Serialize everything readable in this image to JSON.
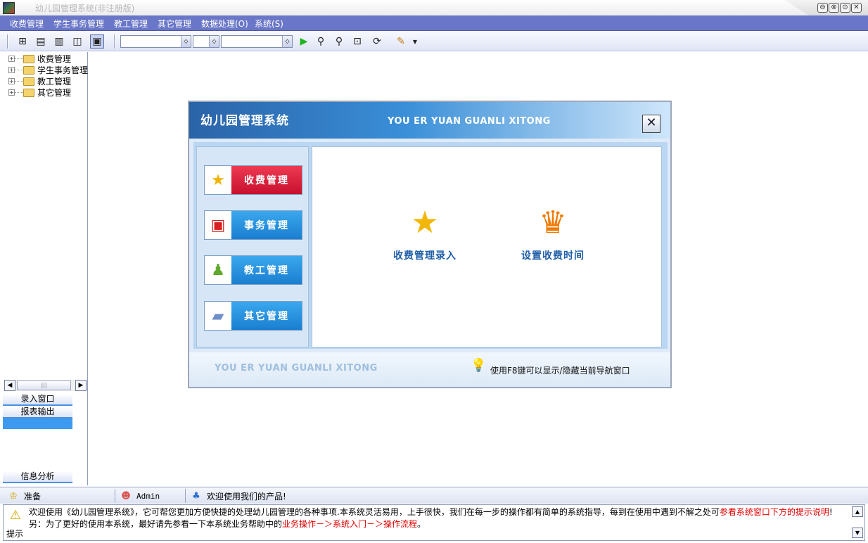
{
  "window": {
    "title": "幼儿园管理系统(非注册版)",
    "buttons": [
      "⊖",
      "⊗",
      "⊙",
      "✕"
    ]
  },
  "menubar": {
    "items": [
      "收费管理",
      "学生事务管理",
      "教工管理",
      "其它管理",
      "数据处理(O)",
      "系统(S)"
    ]
  },
  "tree": {
    "items": [
      {
        "label": "收费管理"
      },
      {
        "label": "学生事务管理"
      },
      {
        "label": "教工管理"
      },
      {
        "label": "其它管理"
      }
    ]
  },
  "left_nav": {
    "entry_window": "录入窗口",
    "report_output": "报表输出",
    "info_analysis": "信息分析"
  },
  "dialog": {
    "title": "幼儿园管理系统",
    "subtitle": "YOU ER YUAN GUANLI XITONG",
    "close": "✕",
    "side_buttons": [
      {
        "label": "收费管理",
        "icon": "star-icon",
        "color": "#d9213a"
      },
      {
        "label": "事务管理",
        "icon": "alert-monitor-icon",
        "color": "#1f8fd8"
      },
      {
        "label": "教工管理",
        "icon": "staff-icon",
        "color": "#1f8fd8"
      },
      {
        "label": "其它管理",
        "icon": "folder-icon",
        "color": "#1f8fd8"
      }
    ],
    "features": [
      {
        "label": "收费管理录入",
        "icon": "star-icon"
      },
      {
        "label": "设置收费时间",
        "icon": "crown-icon"
      }
    ],
    "footer_brand": "YOU ER YUAN GUANLI XITONG",
    "footer_tip": "使用F8键可以显示/隐藏当前导航窗口"
  },
  "statusbar": {
    "ready": "准备",
    "user": "Admin",
    "welcome": "欢迎使用我们的产品!"
  },
  "message": {
    "tag": "提示",
    "line1_a": "欢迎使用《幼儿园管理系统》，它可帮您更加方便快捷的处理幼儿园管理的各种事项.本系统灵活易用，上手很快，我们在每一步的操作都有简单的系统指导，每到在使用中遇到不解之处可",
    "line1_link": "参看系统窗口下方的提示说明",
    "line1_end": "!",
    "line2_a": "另：为了更好的使用本系统，最好请先参看一下本系统业务帮助中的",
    "line2_link": "业务操作－＞系统入门－＞操作流程",
    "line2_end": "。"
  }
}
